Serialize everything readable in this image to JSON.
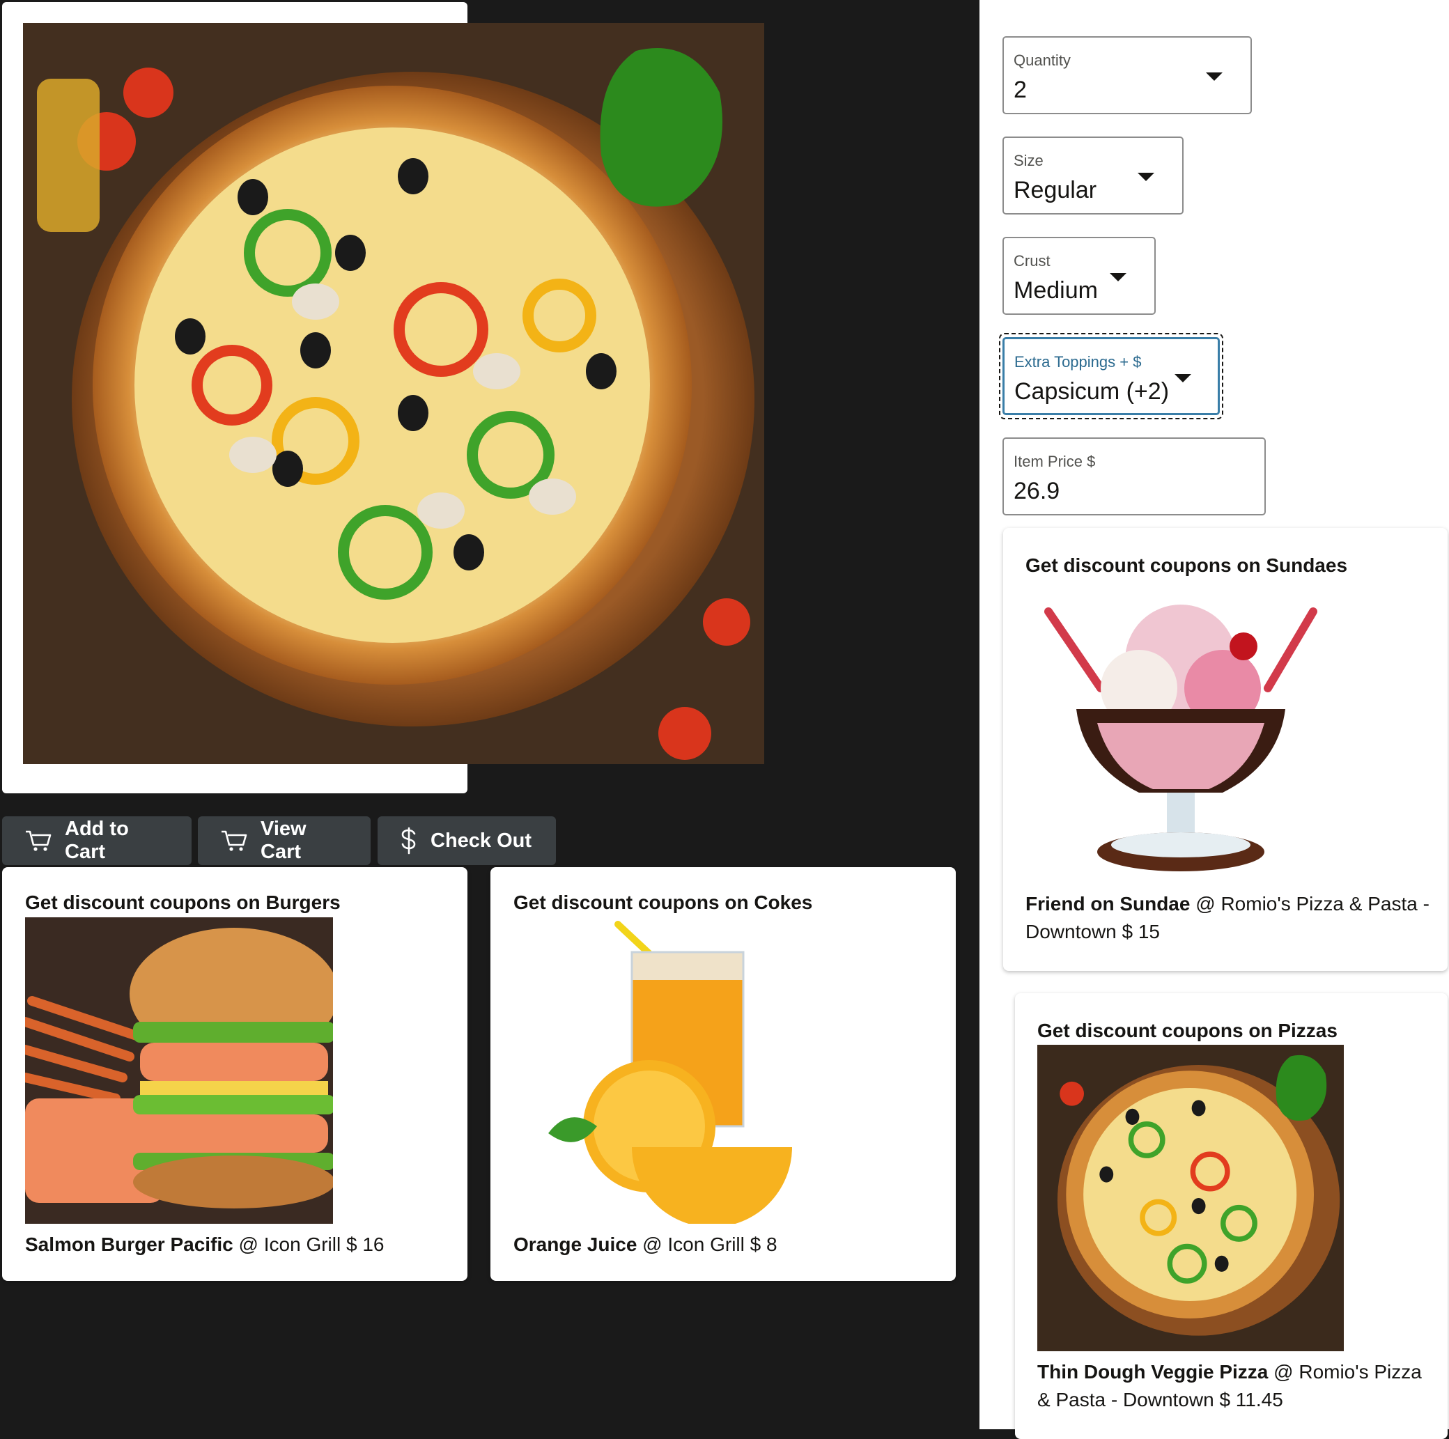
{
  "actions": {
    "add_to_cart": "Add to Cart",
    "view_cart": "View Cart",
    "check_out": "Check Out"
  },
  "form": {
    "quantity": {
      "label": "Quantity",
      "value": "2"
    },
    "size": {
      "label": "Size",
      "value": "Regular"
    },
    "crust": {
      "label": "Crust",
      "value": "Medium"
    },
    "toppings": {
      "label": "Extra Toppings + $",
      "value": "Capsicum (+2)"
    },
    "price": {
      "label": "Item Price $",
      "value": "26.9"
    }
  },
  "coupons": {
    "burgers": {
      "title": "Get discount coupons on Burgers",
      "item": "Salmon Burger Pacific",
      "detail": " @ Icon Grill $ 16"
    },
    "cokes": {
      "title": "Get discount coupons on Cokes",
      "item": "Orange Juice",
      "detail": " @ Icon Grill $ 8"
    },
    "sundaes": {
      "title": "Get discount coupons on Sundaes",
      "item": "Friend on Sundae",
      "detail": " @ Romio's Pizza & Pasta - Downtown $ 15"
    },
    "pizzas": {
      "title": "Get discount coupons on Pizzas",
      "item": "Thin Dough Veggie Pizza",
      "detail": " @ Romio's Pizza & Pasta - Downtown $ 11.45"
    }
  },
  "icons": {
    "cart": "shopping-cart-icon",
    "dollar": "dollar-icon",
    "dropdown": "triangle-down-icon"
  },
  "colors": {
    "button_bg": "#3a3f42",
    "focus_label": "#2b6a8f",
    "focus_border": "#3a7ea8"
  }
}
